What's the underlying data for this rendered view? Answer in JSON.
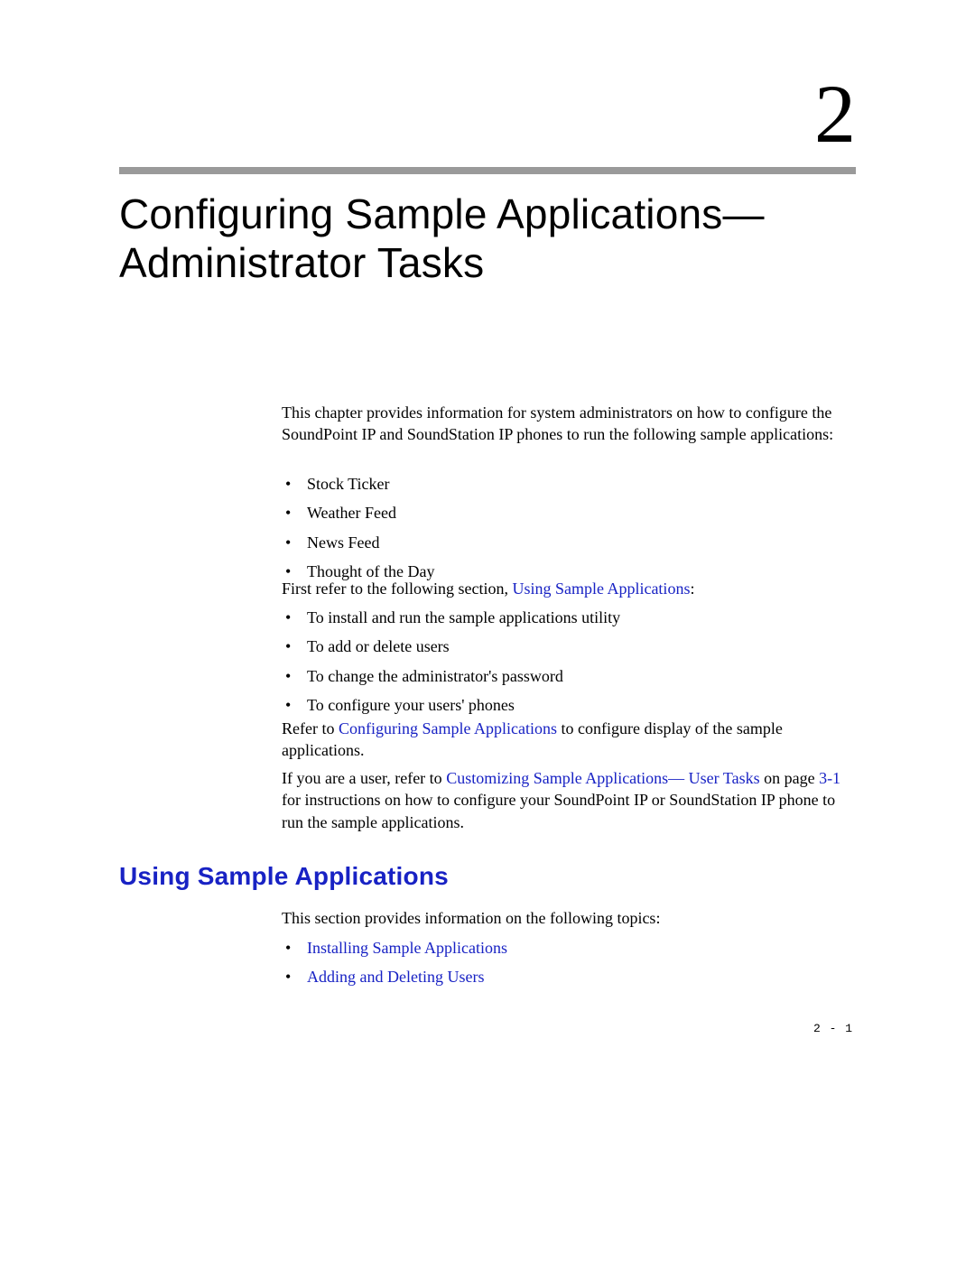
{
  "chapter": {
    "number": "2",
    "title": "Configuring Sample Applications—Administrator Tasks"
  },
  "intro": "This chapter provides information for system administrators on how to configure the SoundPoint IP and SoundStation IP phones to run the following sample applications:",
  "apps": [
    "Stock Ticker",
    "Weather Feed",
    "News Feed",
    "Thought of the Day"
  ],
  "para2_pre": "First refer to the following section, ",
  "para2_link": "Using Sample Applications",
  "para2_post": ":",
  "tasks": [
    "To install and run the sample applications utility",
    "To add or delete users",
    "To change the administrator's password",
    "To configure your users' phones"
  ],
  "para3_pre": "Refer to ",
  "para3_link": "Configuring Sample Applications",
  "para3_post": " to configure display of the sample applications.",
  "para4_pre": "If you are a user, refer to ",
  "para4_link": "Customizing Sample Applications— User Tasks",
  "para4_mid": " on page ",
  "para4_page": "3-1",
  "para4_post": " for instructions on how to configure your SoundPoint IP or SoundStation IP phone to run the sample applications.",
  "section": {
    "heading": "Using Sample Applications",
    "intro": "This section provides information on the following topics:",
    "links": [
      "Installing Sample Applications",
      "Adding and Deleting Users"
    ]
  },
  "page_number": "2 - 1"
}
